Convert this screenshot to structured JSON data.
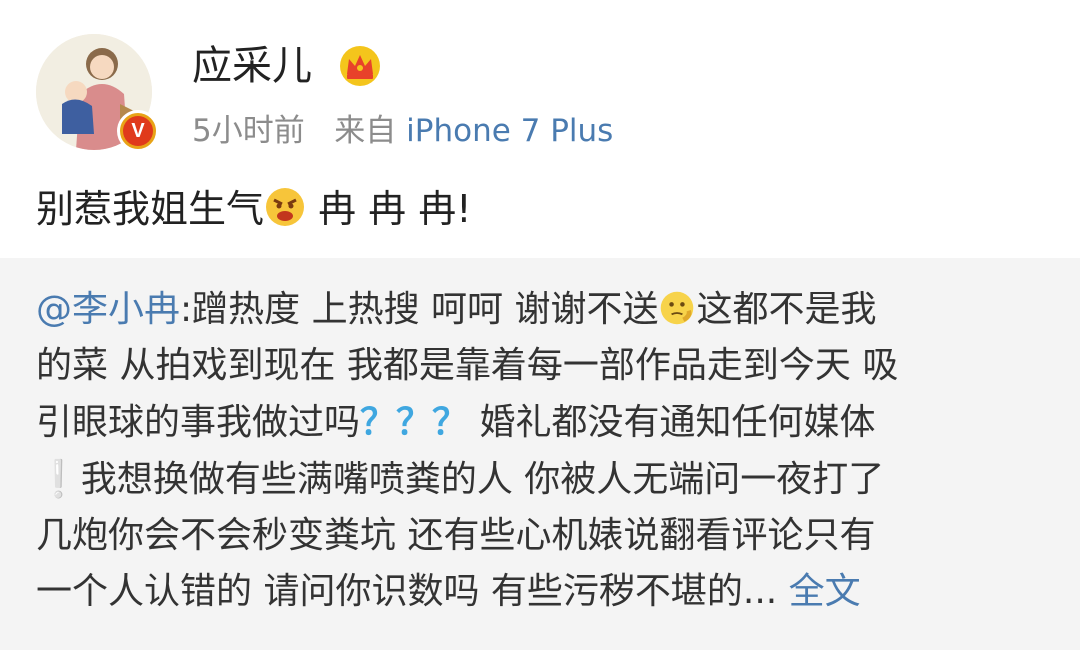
{
  "post": {
    "author": {
      "name": "应采儿",
      "crown_icon": "crown-icon",
      "verified_badge": "V"
    },
    "time": "5小时前",
    "source_prefix": "来自",
    "source": "iPhone 7 Plus",
    "text_part1": "别惹我姐生气",
    "text_emoji": "angry-face-icon",
    "text_part2": " 冉 冉 冉!"
  },
  "repost": {
    "mention": "@李小冉",
    "lines": [
      ":蹭热度 上热搜 呵呵 谢谢不送",
      "这都不是我",
      "的菜 从拍戏到现在 我都是靠着每一部作品走到今天 吸",
      "引眼球的事我做过吗",
      "？？？",
      " 婚礼都没有通知任何媒体",
      "❕",
      "我想换做有些满嘴喷粪的人 你被人无端问一夜打了",
      "几炮你会不会秒变粪坑 还有些心机婊说翻看评论只有",
      "一个人认错的 请问你识数吗 有些污秽不堪的... "
    ],
    "full_text_link": "全文",
    "emoji": "thinking-face-icon"
  },
  "colors": {
    "link": "#4a7bb0",
    "repost_bg": "#f4f4f4",
    "meta": "#8c8c8c",
    "question_mark": "#3fa7e0"
  }
}
